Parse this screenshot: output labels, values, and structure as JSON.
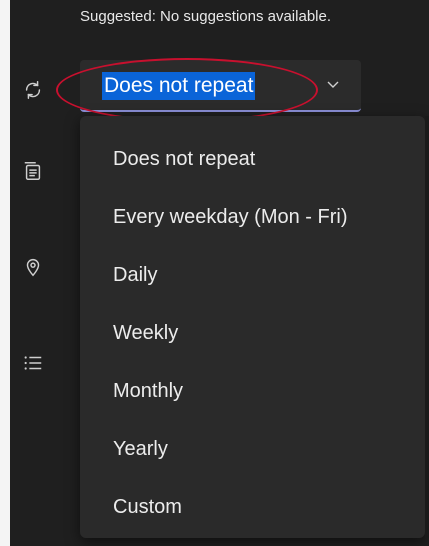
{
  "suggestion": "Suggested: No suggestions available.",
  "icons": [
    "repeat-icon",
    "notes-icon",
    "location-icon",
    "checklist-icon"
  ],
  "repeat_select": {
    "value": "Does not repeat"
  },
  "dropdown": {
    "options": [
      "Does not repeat",
      "Every weekday (Mon - Fri)",
      "Daily",
      "Weekly",
      "Monthly",
      "Yearly",
      "Custom"
    ]
  },
  "colors": {
    "background": "#1f1f1f",
    "menu": "#2a2a2a",
    "selection": "#0a64d8",
    "annotation": "#c8102e",
    "underline": "#8a8fd6"
  }
}
